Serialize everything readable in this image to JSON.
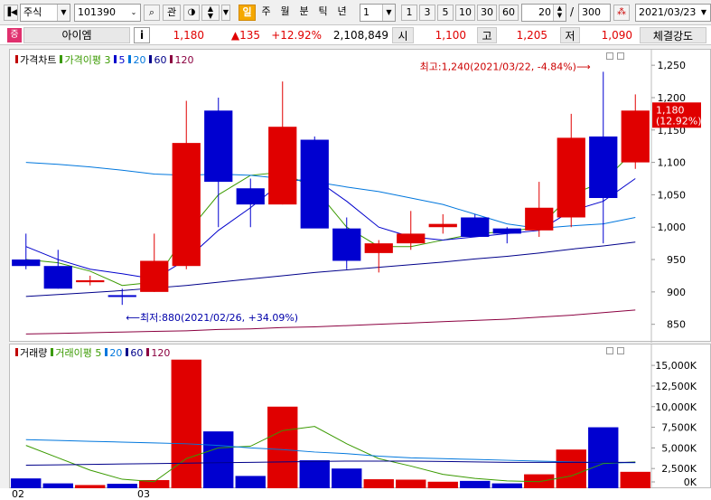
{
  "toolbar": {
    "market_select": "주식",
    "stock_code": "101390",
    "search_label": "관",
    "period_buttons": [
      "일",
      "주",
      "월",
      "분",
      "틱",
      "년"
    ],
    "active_period": "일",
    "interval_value": "1",
    "interval_buttons": [
      "1",
      "3",
      "5",
      "10",
      "30",
      "60"
    ],
    "view_count": "20",
    "total_count": "300",
    "date_value": "2021/03/23"
  },
  "quote": {
    "badge": "증",
    "name": "아이엠",
    "info_label": "i",
    "price": "1,180",
    "change": "▲135",
    "change_pct": "+12.92%",
    "volume": "2,108,849",
    "open_label": "시",
    "open": "1,100",
    "high_label": "고",
    "high": "1,205",
    "low_label": "저",
    "low": "1,090",
    "strength_label": "체결강도"
  },
  "price_chart": {
    "legend": [
      {
        "text": "가격차트",
        "color": "#000000"
      },
      {
        "text": "가격이평 3",
        "color": "#3a9a00"
      },
      {
        "text": "5",
        "color": "#0000cc"
      },
      {
        "text": "20",
        "color": "#0077dd"
      },
      {
        "text": "60",
        "color": "#00008a"
      },
      {
        "text": "120",
        "color": "#8b0040"
      }
    ],
    "max_annotation": "최고:1,240(2021/03/22, -4.84%)",
    "min_annotation": "최저:880(2021/02/26, +34.09%)",
    "current_price_tag": "1,180",
    "current_pct_tag": "(12.92%)",
    "y_ticks": [
      "1,250",
      "1,200",
      "1,150",
      "1,100",
      "1,050",
      "1,000",
      "950",
      "900",
      "850"
    ]
  },
  "volume_chart": {
    "legend": [
      {
        "text": "거래량",
        "color": "#000000"
      },
      {
        "text": "거래이평 5",
        "color": "#3a9a00"
      },
      {
        "text": "20",
        "color": "#0077dd"
      },
      {
        "text": "60",
        "color": "#00008a"
      },
      {
        "text": "120",
        "color": "#8b0040"
      }
    ],
    "y_ticks": [
      "15,000K",
      "12,500K",
      "10,000K",
      "7,500K",
      "5,000K",
      "2,500K",
      "0K"
    ]
  },
  "x_axis": {
    "labels": [
      "02",
      "03"
    ]
  },
  "chart_data": {
    "type": "candlestick",
    "candles": [
      {
        "open": 950,
        "high": 990,
        "low": 935,
        "close": 940
      },
      {
        "open": 940,
        "high": 965,
        "low": 905,
        "close": 905
      },
      {
        "open": 915,
        "high": 925,
        "low": 910,
        "close": 918
      },
      {
        "open": 895,
        "high": 905,
        "low": 880,
        "close": 893
      },
      {
        "open": 900,
        "high": 990,
        "low": 900,
        "close": 948
      },
      {
        "open": 940,
        "high": 1195,
        "low": 935,
        "close": 1130
      },
      {
        "open": 1180,
        "high": 1200,
        "low": 1000,
        "close": 1070
      },
      {
        "open": 1060,
        "high": 1075,
        "low": 1000,
        "close": 1035
      },
      {
        "open": 1035,
        "high": 1225,
        "low": 1035,
        "close": 1155
      },
      {
        "open": 1135,
        "high": 1140,
        "low": 1000,
        "close": 998
      },
      {
        "open": 998,
        "high": 1015,
        "low": 935,
        "close": 948
      },
      {
        "open": 960,
        "high": 980,
        "low": 930,
        "close": 975
      },
      {
        "open": 975,
        "high": 1025,
        "low": 965,
        "close": 990
      },
      {
        "open": 1000,
        "high": 1020,
        "low": 990,
        "close": 1005
      },
      {
        "open": 1015,
        "high": 1020,
        "low": 985,
        "close": 985
      },
      {
        "open": 998,
        "high": 1000,
        "low": 975,
        "close": 990
      },
      {
        "open": 995,
        "high": 1070,
        "low": 985,
        "close": 1030
      },
      {
        "open": 1015,
        "high": 1175,
        "low": 1000,
        "close": 1138
      },
      {
        "open": 1140,
        "high": 1240,
        "low": 975,
        "close": 1045
      },
      {
        "open": 1100,
        "high": 1205,
        "low": 1090,
        "close": 1180
      }
    ],
    "ma": [
      {
        "period": "3",
        "color": "#3a9a00",
        "values": [
          950,
          945,
          932,
          910,
          915,
          990,
          1050,
          1080,
          1085,
          1060,
          1000,
          970,
          970,
          980,
          990,
          993,
          1000,
          1050,
          1070,
          1120
        ]
      },
      {
        "period": "5",
        "color": "#0000cc",
        "values": [
          970,
          950,
          935,
          928,
          920,
          950,
          995,
          1030,
          1070,
          1075,
          1040,
          1000,
          985,
          980,
          985,
          990,
          995,
          1025,
          1040,
          1075
        ]
      },
      {
        "period": "20",
        "color": "#0077dd",
        "values": [
          1100,
          1097,
          1093,
          1088,
          1082,
          1080,
          1082,
          1080,
          1075,
          1070,
          1062,
          1055,
          1045,
          1035,
          1020,
          1005,
          998,
          1002,
          1005,
          1015
        ]
      },
      {
        "period": "60",
        "color": "#00008a",
        "values": [
          893,
          896,
          899,
          902,
          906,
          910,
          915,
          920,
          925,
          930,
          934,
          938,
          942,
          946,
          951,
          955,
          960,
          966,
          971,
          977
        ]
      },
      {
        "period": "120",
        "color": "#8b0040",
        "values": [
          835,
          836,
          837,
          838,
          839,
          840,
          842,
          843,
          845,
          846,
          848,
          850,
          852,
          854,
          856,
          858,
          861,
          864,
          868,
          872
        ]
      }
    ],
    "price_range": [
      830,
      1260
    ],
    "volume_values": [
      1300,
      700,
      500,
      650,
      1100,
      15700,
      7000,
      1600,
      10000,
      3500,
      2500,
      1200,
      1150,
      900,
      1000,
      700,
      1800,
      4800,
      7500,
      2100
    ],
    "volume_range": [
      0,
      16000
    ],
    "volume_ma": [
      {
        "period": "5",
        "color": "#3a9a00",
        "values": [
          5300,
          3800,
          2300,
          1200,
          900,
          3700,
          5000,
          5200,
          7100,
          7600,
          5500,
          3700,
          2800,
          1800,
          1300,
          1000,
          900,
          1600,
          3100,
          3300
        ]
      },
      {
        "period": "20",
        "color": "#0077dd",
        "values": [
          6000,
          5900,
          5800,
          5700,
          5600,
          5500,
          5300,
          5000,
          4800,
          4500,
          4300,
          4000,
          3800,
          3700,
          3600,
          3500,
          3400,
          3300,
          3200,
          3200
        ]
      },
      {
        "period": "60",
        "color": "#00008a",
        "values": [
          2900,
          2950,
          3000,
          3050,
          3100,
          3150,
          3200,
          3250,
          3300,
          3350,
          3400,
          3400,
          3400,
          3350,
          3300,
          3250,
          3250,
          3250,
          3250,
          3250
        ]
      }
    ]
  }
}
